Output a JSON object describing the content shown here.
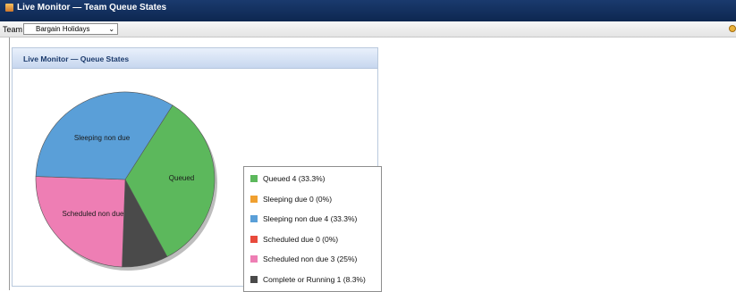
{
  "window": {
    "title": "Live Monitor — Team Queue States"
  },
  "toolbar": {
    "team_label": "Team",
    "team_selected": "Bargain Holidays"
  },
  "panel": {
    "title": "Live Monitor — Queue States"
  },
  "chart_data": {
    "type": "pie",
    "title": "",
    "series": [
      {
        "name": "Queued",
        "value": 4,
        "percent": 33.3,
        "color": "#5cb85c",
        "legend": "Queued 4 (33.3%)",
        "slice_label": "Queued"
      },
      {
        "name": "Sleeping due",
        "value": 0,
        "percent": 0,
        "color": "#f0a030",
        "legend": "Sleeping due 0 (0%)",
        "slice_label": ""
      },
      {
        "name": "Sleeping non due",
        "value": 4,
        "percent": 33.3,
        "color": "#5a9fd8",
        "legend": "Sleeping non due 4 (33.3%)",
        "slice_label": "Sleeping non due"
      },
      {
        "name": "Scheduled due",
        "value": 0,
        "percent": 0,
        "color": "#e84a3c",
        "legend": "Scheduled due 0 (0%)",
        "slice_label": ""
      },
      {
        "name": "Scheduled non due",
        "value": 3,
        "percent": 25,
        "color": "#ee7eb4",
        "legend": "Scheduled non due 3 (25%)",
        "slice_label": "Scheduled non due"
      },
      {
        "name": "Complete or Running",
        "value": 1,
        "percent": 8.3,
        "color": "#4a4a4a",
        "legend": "Complete or Running 1 (8.3%)",
        "slice_label": ""
      }
    ],
    "legend_position": "right"
  }
}
